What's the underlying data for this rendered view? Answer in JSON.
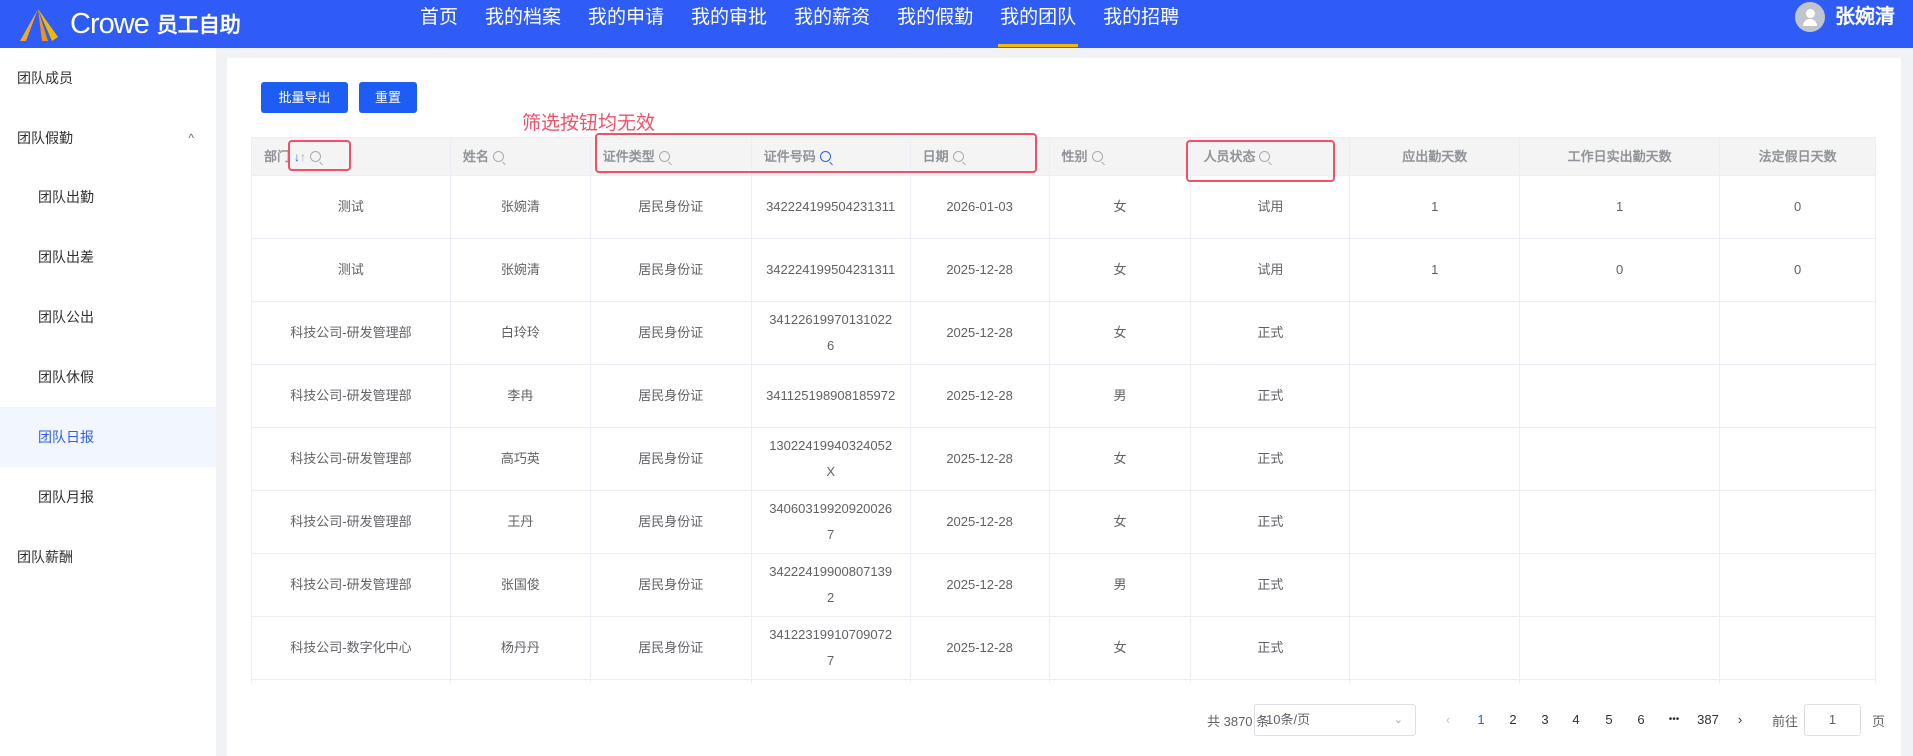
{
  "header": {
    "brand": "Crowe",
    "app_name": "员工自助",
    "nav": [
      "首页",
      "我的档案",
      "我的申请",
      "我的审批",
      "我的薪资",
      "我的假勤",
      "我的团队",
      "我的招聘"
    ],
    "active_nav": 6,
    "user": "张婉清"
  },
  "sidebar": {
    "items": [
      {
        "label": "团队成员"
      },
      {
        "label": "团队假勤"
      },
      {
        "label": "团队出勤"
      },
      {
        "label": "团队出差"
      },
      {
        "label": "团队公出"
      },
      {
        "label": "团队休假"
      },
      {
        "label": "团队日报"
      },
      {
        "label": "团队月报"
      },
      {
        "label": "团队薪酬"
      }
    ],
    "expand_icon": "^"
  },
  "toolbar": {
    "export": "批量导出",
    "reset": "重置"
  },
  "annotation": "筛选按钮均无效",
  "table": {
    "columns": [
      "部门",
      "姓名",
      "证件类型",
      "证件号码",
      "日期",
      "性别",
      "人员状态",
      "应出勤天数",
      "工作日实出勤天数",
      "法定假日天数"
    ],
    "sort_icons": {
      "asc": "↓",
      "desc": "↑"
    },
    "rows": [
      [
        "测试",
        "张婉清",
        "居民身份证",
        "342224199504231311",
        "2026-01-03",
        "女",
        "试用",
        "1",
        "1",
        "0"
      ],
      [
        "测试",
        "张婉清",
        "居民身份证",
        "342224199504231311",
        "2025-12-28",
        "女",
        "试用",
        "1",
        "0",
        "0"
      ],
      [
        "科技公司-研发管理部",
        "白玲玲",
        "居民身份证",
        "341226199701310226",
        "2025-12-28",
        "女",
        "正式",
        "",
        "",
        ""
      ],
      [
        "科技公司-研发管理部",
        "李冉",
        "居民身份证",
        "341125198908185972",
        "2025-12-28",
        "男",
        "正式",
        "",
        "",
        ""
      ],
      [
        "科技公司-研发管理部",
        "高巧英",
        "居民身份证",
        "13022419940324052X",
        "2025-12-28",
        "女",
        "正式",
        "",
        "",
        ""
      ],
      [
        "科技公司-研发管理部",
        "王丹",
        "居民身份证",
        "340603199209200267",
        "2025-12-28",
        "女",
        "正式",
        "",
        "",
        ""
      ],
      [
        "科技公司-研发管理部",
        "张国俊",
        "居民身份证",
        "342224199008071392",
        "2025-12-28",
        "男",
        "正式",
        "",
        "",
        ""
      ],
      [
        "科技公司-数字化中心",
        "杨丹丹",
        "居民身份证",
        "341223199107090727",
        "2025-12-28",
        "女",
        "正式",
        "",
        "",
        ""
      ]
    ]
  },
  "pagination": {
    "total": "共 3870 条",
    "page_size": "10条/页",
    "pages": [
      "1",
      "2",
      "3",
      "4",
      "5",
      "6",
      "•••",
      "387"
    ],
    "current": "1",
    "prev": "‹",
    "next": "›",
    "goto_label": "前往",
    "goto_value": "1",
    "page_suffix": "页"
  },
  "colors": {
    "header": "#2f5cf6",
    "accent": "#1d5cf5",
    "annotation": "#f25069",
    "nav_underline": "#f5b800"
  }
}
